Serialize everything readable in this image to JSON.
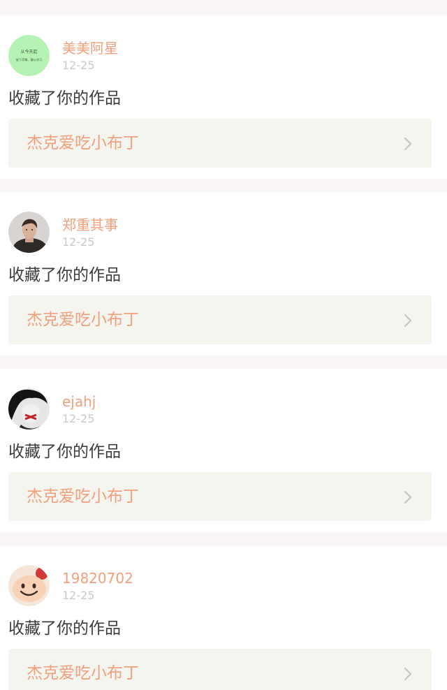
{
  "feed": {
    "items": [
      {
        "avatar_icon": "green-text-avatar-icon",
        "avatar_text_line1": "从今天起",
        "avatar_text_line2": "放下浮躁，静心学习",
        "username": "美美阿星",
        "date": "12-25",
        "action": "收藏了你的作品",
        "work_title": "杰克爱吃小布丁"
      },
      {
        "avatar_icon": "man-portrait-avatar-icon",
        "username": "郑重其事",
        "date": "12-25",
        "action": "收藏了你的作品",
        "work_title": "杰克爱吃小布丁"
      },
      {
        "avatar_icon": "bw-portrait-avatar-icon",
        "username": "ejahj",
        "date": "12-25",
        "action": "收藏了你的作品",
        "work_title": "杰克爱吃小布丁"
      },
      {
        "avatar_icon": "smiley-avatar-icon",
        "username": "19820702",
        "date": "12-25",
        "action": "收藏了你的作品",
        "work_title": "杰克爱吃小布丁"
      }
    ]
  },
  "colors": {
    "page_background": "#fbf6f6",
    "card_background": "#ffffff",
    "accent": "#f1a07d",
    "date_text": "#c9c9c9",
    "body_text": "#3c3c3c",
    "link_background": "#f5f5ef",
    "chevron": "#c4c4c4"
  }
}
